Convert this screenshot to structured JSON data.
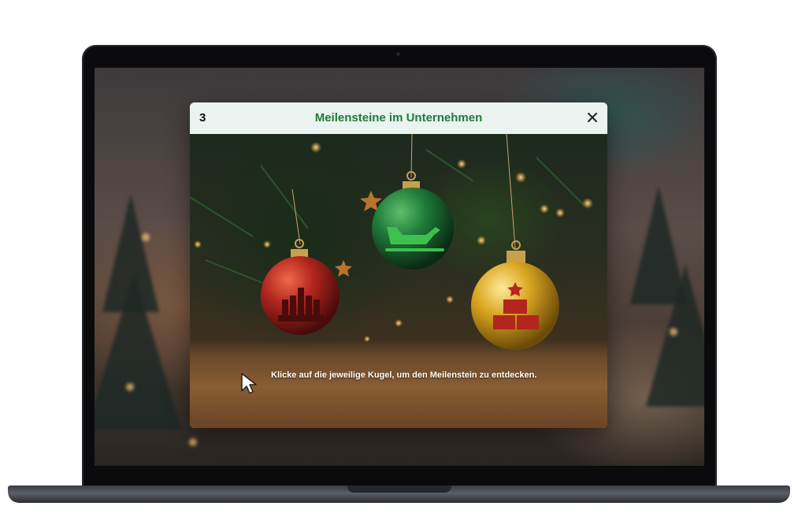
{
  "modal": {
    "door_number": "3",
    "title": "Meilensteine im Unternehmen",
    "close_icon": "close-icon",
    "instruction": "Klicke auf die jeweilige Kugel, um den Meilenstein zu entdecken."
  },
  "ornaments": [
    {
      "name": "red-ornament",
      "color": "#b3261e",
      "icon": "candles-icon"
    },
    {
      "name": "green-ornament",
      "color": "#1f7a3a",
      "icon": "sleigh-icon"
    },
    {
      "name": "gold-ornament",
      "color": "#d9a520",
      "icon": "gift-stack-icon"
    }
  ],
  "colors": {
    "accent_green": "#1f7a3a",
    "header_bg": "#eaf3ef"
  }
}
